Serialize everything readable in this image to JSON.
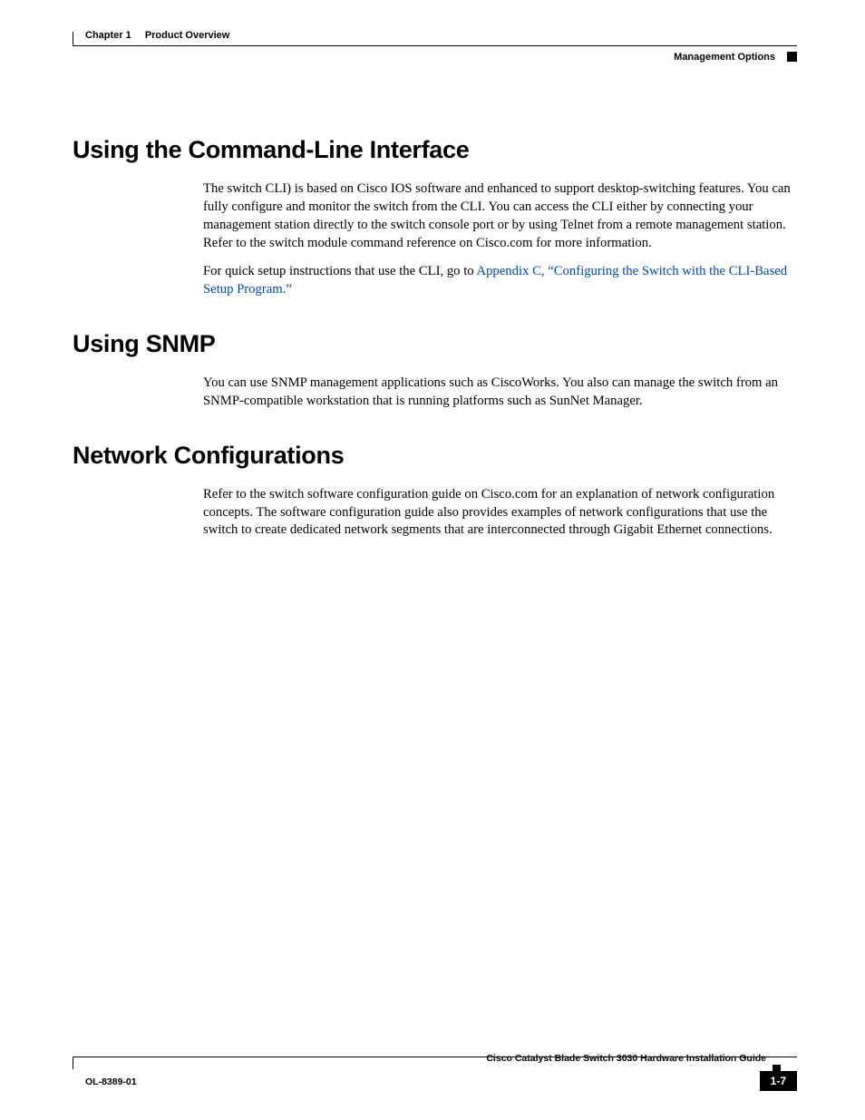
{
  "header": {
    "chapter_label": "Chapter 1",
    "chapter_title": "Product Overview",
    "section": "Management Options"
  },
  "sections": {
    "cli": {
      "heading": "Using the Command-Line Interface",
      "p1": "The switch CLI) is based on Cisco IOS software and enhanced to support desktop-switching features. You can fully configure and monitor the switch from the CLI. You can access the CLI either by connecting your management station directly to the switch console port or by using Telnet from a remote management station. Refer to the switch module command reference on Cisco.com for more information.",
      "p2_pre": "For quick setup instructions that use the CLI, go to ",
      "p2_link": "Appendix C, “Configuring the Switch with the CLI-Based Setup Program.”"
    },
    "snmp": {
      "heading": "Using SNMP",
      "p1": "You can use SNMP management applications such as CiscoWorks. You also can manage the switch from an SNMP-compatible workstation that is running platforms such as SunNet Manager."
    },
    "netconf": {
      "heading": "Network Configurations",
      "p1": "Refer to the switch software configuration guide on Cisco.com for an explanation of network configuration concepts. The software configuration guide also provides examples of network configurations that use the switch to create dedicated network segments that are interconnected through Gigabit Ethernet connections."
    }
  },
  "footer": {
    "guide_title": "Cisco Catalyst Blade Switch 3030 Hardware Installation Guide",
    "doc_number": "OL-8389-01",
    "page_number": "1-7"
  }
}
